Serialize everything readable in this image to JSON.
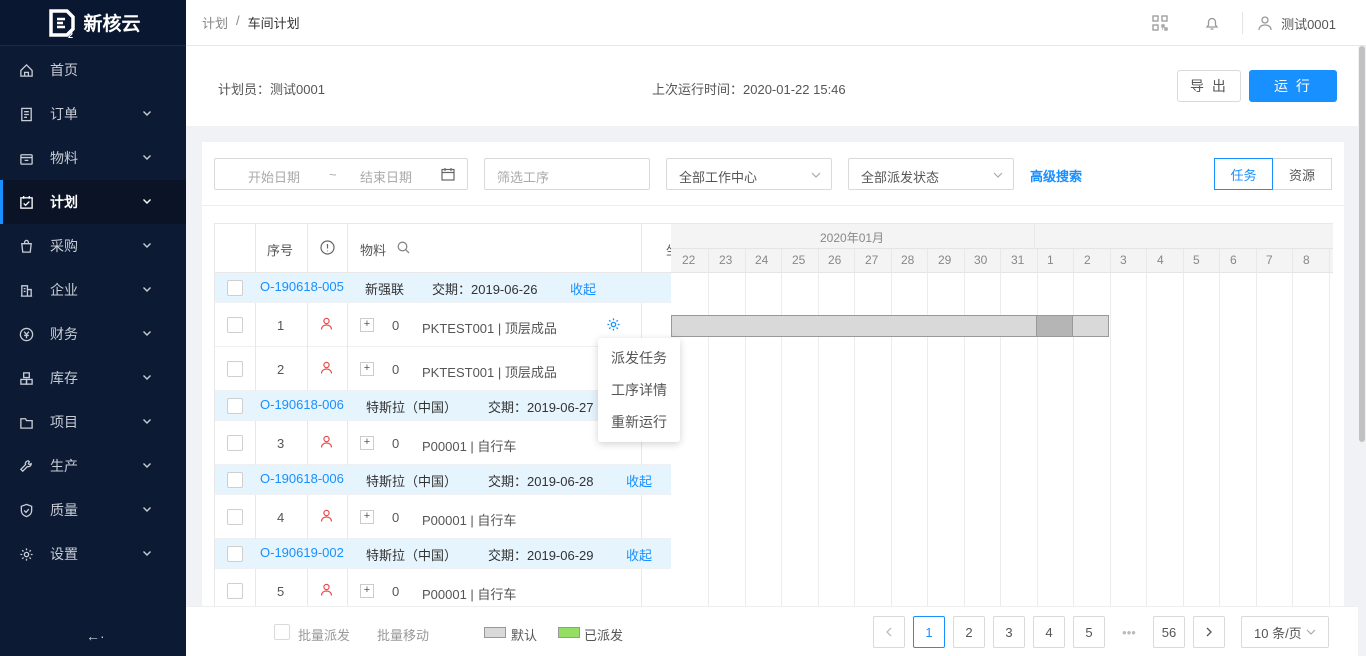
{
  "sidebar": {
    "brand": "新核云",
    "items": [
      {
        "label": "首页",
        "icon": "home-icon",
        "chevron": false
      },
      {
        "label": "订单",
        "icon": "order-icon",
        "chevron": true
      },
      {
        "label": "物料",
        "icon": "material-icon",
        "chevron": true
      },
      {
        "label": "计划",
        "icon": "plan-icon",
        "chevron": true,
        "active": true
      },
      {
        "label": "采购",
        "icon": "purchase-icon",
        "chevron": true
      },
      {
        "label": "企业",
        "icon": "enterprise-icon",
        "chevron": true
      },
      {
        "label": "财务",
        "icon": "finance-icon",
        "chevron": true
      },
      {
        "label": "库存",
        "icon": "inventory-icon",
        "chevron": true
      },
      {
        "label": "项目",
        "icon": "project-icon",
        "chevron": true
      },
      {
        "label": "生产",
        "icon": "production-icon",
        "chevron": true
      },
      {
        "label": "质量",
        "icon": "quality-icon",
        "chevron": true
      },
      {
        "label": "设置",
        "icon": "settings-icon",
        "chevron": true
      }
    ],
    "collapse": "←·"
  },
  "topbar": {
    "breadcrumb": [
      "计划",
      "/",
      "车间计划"
    ],
    "user": "测试0001"
  },
  "info": {
    "planner": "计划员：测试0001",
    "last_run": "上次运行时间：2020-01-22 15:46",
    "export_label": "导 出",
    "run_label": "运 行"
  },
  "filters": {
    "start_placeholder": "开始日期",
    "tilde": "~",
    "end_placeholder": "结束日期",
    "process_placeholder": "筛选工序",
    "work_center": "全部工作中心",
    "dispatch_status": "全部派发状态",
    "advanced": "高级搜索",
    "view_task": "任务",
    "view_resource": "资源"
  },
  "table": {
    "headers": {
      "seq": "序号",
      "material": "物料",
      "cut": "坐"
    },
    "rows": [
      {
        "type": "group",
        "order": "O-190618-005",
        "customer": "新强联",
        "due": "交期：2019-06-26",
        "action": "收起"
      },
      {
        "type": "item",
        "seq": "1",
        "qty": "0",
        "material": "PKTEST001 | 顶层成品",
        "gear": true
      },
      {
        "type": "item",
        "seq": "2",
        "qty": "0",
        "material": "PKTEST001 | 顶层成品"
      },
      {
        "type": "group",
        "order": "O-190618-006",
        "customer": "特斯拉（中国）",
        "due": "交期：2019-06-27",
        "action": "收起"
      },
      {
        "type": "item",
        "seq": "3",
        "qty": "0",
        "material": "P00001 | 自行车"
      },
      {
        "type": "group",
        "order": "O-190618-006",
        "customer": "特斯拉（中国）",
        "due": "交期：2019-06-28",
        "action": "收起"
      },
      {
        "type": "item",
        "seq": "4",
        "qty": "0",
        "material": "P00001 | 自行车"
      },
      {
        "type": "group",
        "order": "O-190619-002",
        "customer": "特斯拉（中国）",
        "due": "交期：2019-06-29",
        "action": "收起"
      },
      {
        "type": "item",
        "seq": "5",
        "qty": "0",
        "material": "P00001 | 自行车"
      }
    ]
  },
  "gantt": {
    "month": "2020年01月",
    "days": [
      "22",
      "23",
      "24",
      "25",
      "26",
      "27",
      "28",
      "29",
      "30",
      "31",
      "1",
      "2",
      "3",
      "4",
      "5",
      "6",
      "7",
      "8"
    ],
    "bar": {
      "start_day_index": 0,
      "end_day_index": 11,
      "dark_day_index": 10
    }
  },
  "context_menu": [
    "派发任务",
    "工序详情",
    "重新运行"
  ],
  "footer": {
    "batch_dispatch": "批量派发",
    "batch_move": "批量移动",
    "legend_default": "默认",
    "legend_dispatched": "已派发",
    "pages": [
      "1",
      "2",
      "3",
      "4",
      "5"
    ],
    "ellipsis": "•••",
    "last_page": "56",
    "current_page": "1",
    "page_size": "10 条/页"
  },
  "colors": {
    "accent": "#1890ff",
    "sidebar": "#0c1a33",
    "group_row": "#e6f4fd",
    "dispatched": "#95de64",
    "default_bar": "#d9d9d9"
  }
}
